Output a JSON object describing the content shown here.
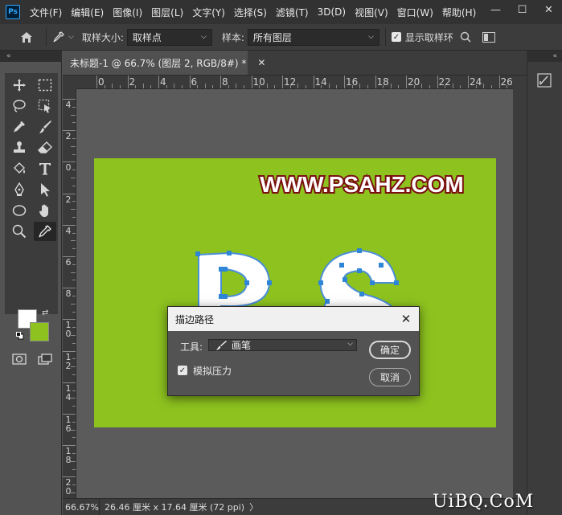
{
  "menubar": {
    "logo": "Ps",
    "items": [
      "文件(F)",
      "编辑(E)",
      "图像(I)",
      "图层(L)",
      "文字(Y)",
      "选择(S)",
      "滤镜(T)",
      "3D(D)",
      "视图(V)",
      "窗口(W)",
      "帮助(H)"
    ],
    "minimize": "—",
    "maximize": "☐",
    "close": "✕"
  },
  "options": {
    "sample_size_label": "取样大小:",
    "sample_size_value": "取样点",
    "sample_label": "样本:",
    "sample_value": "所有图层",
    "show_ring_label": "显示取样环"
  },
  "document": {
    "tab_title": "未标题-1 @ 66.7% (图层 2, RGB/8#) *",
    "collapse_left": "«",
    "collapse_right": "«"
  },
  "ruler": {
    "h_labels": [
      "0",
      "2",
      "4",
      "6",
      "8",
      "10",
      "12",
      "14",
      "16",
      "18",
      "20",
      "22",
      "24",
      "26"
    ],
    "v_labels": [
      "4",
      "2",
      "0",
      "2",
      "4",
      "6",
      "8",
      "10",
      "12",
      "14",
      "16",
      "18",
      "20"
    ]
  },
  "canvas": {
    "bg_color": "#8dc21f",
    "title_text": "WWW.PSAHZ.COM",
    "letters": "PS"
  },
  "dialog": {
    "title": "描边路径",
    "tool_label": "工具:",
    "tool_value": "画笔",
    "pressure_label": "模拟压力",
    "ok": "确定",
    "cancel": "取消"
  },
  "status": {
    "zoom": "66.67%",
    "size": "26.46 厘米 x 17.64 厘米 (72 ppi)",
    "more": "〉"
  },
  "watermark": "UiBQ.CoM",
  "colors": {
    "foreground": "#ffffff",
    "background": "#8dc21f",
    "accent": "#31a8ff"
  }
}
